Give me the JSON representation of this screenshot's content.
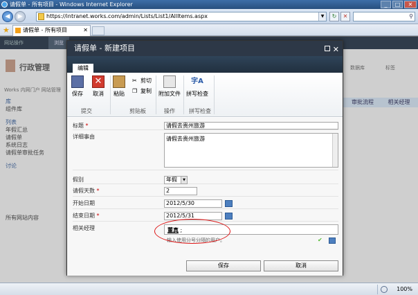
{
  "window": {
    "title": "请假单 - 所有项目 - Windows Internet Explorer",
    "url": "https://intranet.works.com/admin/Lists/List1/AllItems.aspx",
    "tab_label": "请假单 - 所有项目",
    "zoom": "100%"
  },
  "background_page": {
    "top_bar_label": "网站操作",
    "browse_label": "浏览",
    "site_title": "行政管理",
    "breadcrumb": "Works 内网门户    网站管理",
    "nav": [
      "库",
      "组件库",
      "列表",
      "年假汇总",
      "请假单",
      "系统日志",
      "请假单审批任务",
      "讨论"
    ],
    "right_label_1": "数据库",
    "right_label_2": "标签",
    "right_bar_1": "审批流程",
    "right_bar_2": "相关经理",
    "all_site_content": "所有网站内容"
  },
  "dialog": {
    "title": "请假单 - 新建项目",
    "ribbon_tab": "编辑",
    "buttons": {
      "save": "保存",
      "cancel": "取消",
      "paste": "粘贴",
      "cut": "剪切",
      "copy": "复制",
      "attach": "附加文件",
      "spell": "拼写检查",
      "spell_icon": "字A"
    },
    "groups": {
      "commit": "提交",
      "clipboard": "剪贴板",
      "actions": "操作",
      "spelling": "拼写检查"
    },
    "fields": {
      "title_label": "标题",
      "title_value": "请假去贵州旅游",
      "detail_label": "详细事由",
      "detail_value": "请假去贵州旅游",
      "type_label": "假别",
      "type_value": "年假",
      "days_label": "请假天数",
      "days_value": "2",
      "start_label": "开始日期",
      "start_value": "2012/5/30",
      "end_label": "结束日期",
      "end_value": "2012/5/31",
      "manager_label": "相关经理",
      "manager_value": "董真",
      "manager_suffix": ";",
      "manager_hint": "输入使用分号分隔的用户。"
    },
    "footer": {
      "ok": "保存",
      "cancel": "取消"
    }
  },
  "colors": {
    "dialog_title_bg": "#2d3847",
    "required": "#cc0000",
    "annotation": "#dd1111"
  }
}
